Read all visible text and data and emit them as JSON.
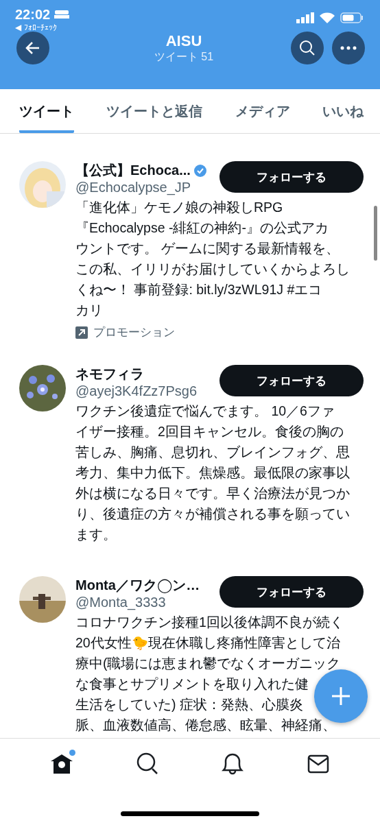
{
  "status_bar": {
    "time": "22:02",
    "back_app": "◀ ﾌｫﾛｰﾁｪｯｸ"
  },
  "header": {
    "title": "AISU",
    "subtitle": "ツイート 51"
  },
  "tabs": [
    {
      "label": "ツイート",
      "selected": true
    },
    {
      "label": "ツイートと返信",
      "selected": false
    },
    {
      "label": "メディア",
      "selected": false
    },
    {
      "label": "いいね",
      "selected": false
    }
  ],
  "users": [
    {
      "name": "【公式】Echoca...",
      "verified": true,
      "handle": "@Echocalypse_JP",
      "follow_button": "フォローする",
      "bio_lines": [
        "「進化体」ケモノ娘の神殺しRPG",
        "『Echocalypse -緋紅の神約-』の公式アカ",
        "ウントです。 ゲームに関する最新情報を、",
        "この私、イリリがお届けしていくからよろし",
        "くね〜！ 事前登録: bit.ly/3zWL91J #エコ",
        "カリ"
      ],
      "promotion": "プロモーション"
    },
    {
      "name": "ネモフィラ",
      "handle": "@ayej3K4fZz7Psg6",
      "follow_button": "フォローする",
      "bio_lines": [
        "ワクチン後遺症で悩んでます。 10／6ファ",
        "イザー接種。2回目キャンセル。食後の胸の",
        "苦しみ、胸痛、息切れ、ブレインフォグ、思",
        "考力、集中力低下。焦燥感。最低限の家事以",
        "外は横になる日々です。早く治療法が見つか",
        "り、後遺症の方々が補償される事を願ってい",
        "ます。"
      ]
    },
    {
      "name": "Monta／ワク◯ン…",
      "handle": "@Monta_3333",
      "follow_button": "フォローする",
      "bio_lines": [
        "コロナワクチン接種1回以後体調不良が続く",
        "20代女性🐤現在休職し疼痛性障害として治",
        "療中(職場には恵まれ鬱でなくオーガニック",
        "な食事とサプリメントを取り入れた健",
        "生活をしていた) 症状：発熱、心膜炎",
        "脈、血液数値高、倦怠感、眩暈、神経痛、"
      ]
    }
  ],
  "bottom_nav": [
    {
      "kind": "home",
      "selected": true,
      "badge": true
    },
    {
      "kind": "search",
      "selected": false
    },
    {
      "kind": "bell",
      "selected": false
    },
    {
      "kind": "mail",
      "selected": false
    }
  ]
}
